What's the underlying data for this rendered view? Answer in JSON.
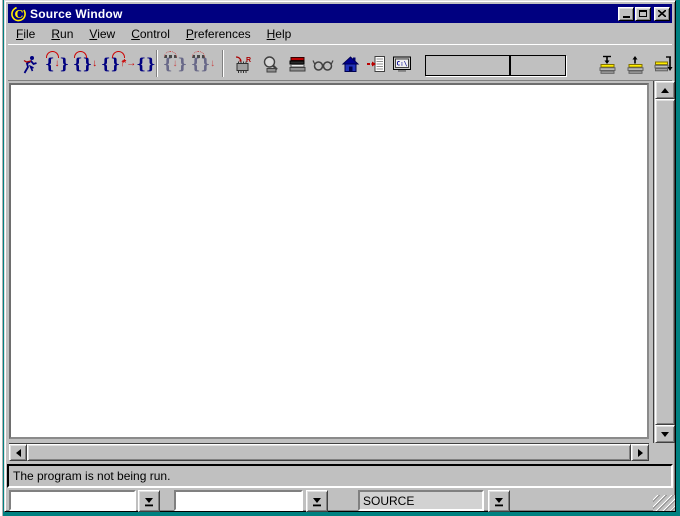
{
  "window": {
    "title": "Source Window"
  },
  "menu": {
    "items": [
      {
        "first": "F",
        "rest": "ile"
      },
      {
        "first": "R",
        "rest": "un"
      },
      {
        "first": "V",
        "rest": "iew"
      },
      {
        "first": "C",
        "rest": "ontrol"
      },
      {
        "first": "P",
        "rest": "references"
      },
      {
        "first": "H",
        "rest": "elp"
      }
    ]
  },
  "toolbar": {
    "glyphs": {
      "brace_open": "{",
      "brace_close": "}",
      "arrow_down": "↓",
      "arrow_up": "↑",
      "arrow_right": "→",
      "star": "*",
      "registers_letter": "R",
      "console_label": "C:\\"
    },
    "status_boxes": {
      "left": "",
      "right": ""
    }
  },
  "source_area": {
    "content": ""
  },
  "statusbar": {
    "message": "The program is not being run."
  },
  "combos": {
    "file_value": "",
    "function_value": "",
    "mode_value": "SOURCE"
  },
  "colors": {
    "titlebar": "#000080",
    "desktop": "#008080",
    "window_bg": "#c0c0c0",
    "icon_blue": "#000080",
    "icon_red": "#cc0000",
    "logo_yellow": "#ffee00"
  }
}
